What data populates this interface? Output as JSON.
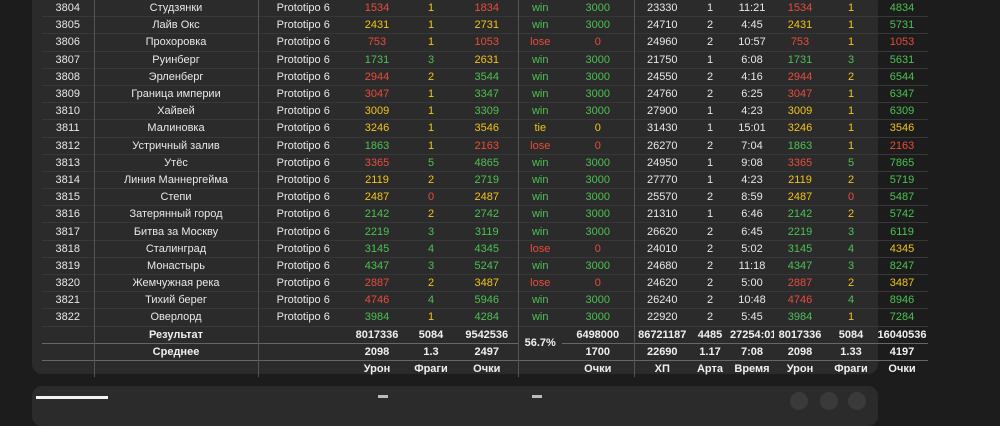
{
  "rows": [
    [
      "3804",
      "Студзянки",
      "Prototipo 6",
      "1534",
      "1",
      "1834",
      "win",
      "3000",
      "23330",
      "1",
      "11:21",
      "1534",
      "1",
      "4834"
    ],
    [
      "3805",
      "Лайв Окс",
      "Prototipo 6",
      "2431",
      "1",
      "2731",
      "win",
      "3000",
      "24710",
      "2",
      "4:45",
      "2431",
      "1",
      "5731"
    ],
    [
      "3806",
      "Прохоровка",
      "Prototipo 6",
      "753",
      "1",
      "1053",
      "lose",
      "0",
      "24960",
      "2",
      "10:57",
      "753",
      "1",
      "1053"
    ],
    [
      "3807",
      "Руинберг",
      "Prototipo 6",
      "1731",
      "3",
      "2631",
      "win",
      "3000",
      "21750",
      "1",
      "6:08",
      "1731",
      "3",
      "5631"
    ],
    [
      "3808",
      "Эрленберг",
      "Prototipo 6",
      "2944",
      "2",
      "3544",
      "win",
      "3000",
      "24550",
      "2",
      "4:16",
      "2944",
      "2",
      "6544"
    ],
    [
      "3809",
      "Граница империи",
      "Prototipo 6",
      "3047",
      "1",
      "3347",
      "win",
      "3000",
      "24760",
      "2",
      "6:25",
      "3047",
      "1",
      "6347"
    ],
    [
      "3810",
      "Хайвей",
      "Prototipo 6",
      "3009",
      "1",
      "3309",
      "win",
      "3000",
      "27900",
      "1",
      "4:23",
      "3009",
      "1",
      "6309"
    ],
    [
      "3811",
      "Малиновка",
      "Prototipo 6",
      "3246",
      "1",
      "3546",
      "tie",
      "0",
      "31430",
      "1",
      "15:01",
      "3246",
      "1",
      "3546"
    ],
    [
      "3812",
      "Устричный залив",
      "Prototipo 6",
      "1863",
      "1",
      "2163",
      "lose",
      "0",
      "26270",
      "2",
      "7:04",
      "1863",
      "1",
      "2163"
    ],
    [
      "3813",
      "Утёс",
      "Prototipo 6",
      "3365",
      "5",
      "4865",
      "win",
      "3000",
      "24950",
      "1",
      "9:08",
      "3365",
      "5",
      "7865"
    ],
    [
      "3814",
      "Линия Маннергейма",
      "Prototipo 6",
      "2119",
      "2",
      "2719",
      "win",
      "3000",
      "27770",
      "1",
      "4:23",
      "2119",
      "2",
      "5719"
    ],
    [
      "3815",
      "Степи",
      "Prototipo 6",
      "2487",
      "0",
      "2487",
      "win",
      "3000",
      "25570",
      "2",
      "8:59",
      "2487",
      "0",
      "5487"
    ],
    [
      "3816",
      "Затерянный город",
      "Prototipo 6",
      "2142",
      "2",
      "2742",
      "win",
      "3000",
      "21310",
      "1",
      "6:46",
      "2142",
      "2",
      "5742"
    ],
    [
      "3817",
      "Битва за Москву",
      "Prototipo 6",
      "2219",
      "3",
      "3119",
      "win",
      "3000",
      "26620",
      "2",
      "6:45",
      "2219",
      "3",
      "6119"
    ],
    [
      "3818",
      "Сталинград",
      "Prototipo 6",
      "3145",
      "4",
      "4345",
      "lose",
      "0",
      "24010",
      "2",
      "5:02",
      "3145",
      "4",
      "4345"
    ],
    [
      "3819",
      "Монастырь",
      "Prototipo 6",
      "4347",
      "3",
      "5247",
      "win",
      "3000",
      "24680",
      "2",
      "11:18",
      "4347",
      "3",
      "8247"
    ],
    [
      "3820",
      "Жемчужная река",
      "Prototipo 6",
      "2887",
      "2",
      "3487",
      "lose",
      "0",
      "24620",
      "2",
      "5:00",
      "2887",
      "2",
      "3487"
    ],
    [
      "3821",
      "Тихий берег",
      "Prototipo 6",
      "4746",
      "4",
      "5946",
      "win",
      "3000",
      "26240",
      "2",
      "10:48",
      "4746",
      "4",
      "8946"
    ],
    [
      "3822",
      "Оверлорд",
      "Prototipo 6",
      "3984",
      "1",
      "4284",
      "win",
      "3000",
      "22920",
      "2",
      "5:45",
      "3984",
      "1",
      "7284"
    ]
  ],
  "colors": [
    [
      "red",
      "yel",
      "red",
      "grn",
      "red",
      "red",
      "yel",
      "yel",
      "grn",
      "red",
      "yel",
      "yel",
      "grn",
      "grn",
      "grn",
      "grn",
      "red",
      "red",
      "grn"
    ],
    [
      "yel",
      "yel",
      "yel",
      "grn",
      "yel",
      "yel",
      "yel",
      "yel",
      "yel",
      "grn",
      "yel",
      "red",
      "yel",
      "grn",
      "grn",
      "grn",
      "yel",
      "grn",
      "yel"
    ],
    [
      "red",
      "yel",
      "red",
      "yel",
      "grn",
      "grn",
      "grn",
      "yel",
      "red",
      "grn",
      "grn",
      "yel",
      "grn",
      "grn",
      "grn",
      "grn",
      "yel",
      "grn",
      "grn"
    ]
  ],
  "total_colors": [
    "grn",
    "grn",
    "red",
    "grn",
    "grn",
    "grn",
    "grn",
    "yel",
    "red",
    "grn",
    "grn",
    "grn",
    "grn",
    "grn",
    "yel",
    "grn",
    "yel",
    "grn",
    "grn"
  ],
  "footer": {
    "result_label": "Результат",
    "result": [
      "8017336",
      "5084",
      "9542536",
      "6498000",
      "86721187",
      "4485",
      "27254:01",
      "8017336",
      "5084",
      "16040536"
    ],
    "winrate": "56.7%",
    "avg_label": "Среднее",
    "avg": [
      "2098",
      "1.3",
      "2497",
      "1700",
      "22690",
      "1.17",
      "7:08",
      "2098",
      "1.33",
      "4197"
    ],
    "headers": [
      "Урон",
      "Фраги",
      "Очки",
      "Очки",
      "ХП",
      "Арта",
      "Время",
      "Урон",
      "Фраги",
      "Очки"
    ]
  }
}
